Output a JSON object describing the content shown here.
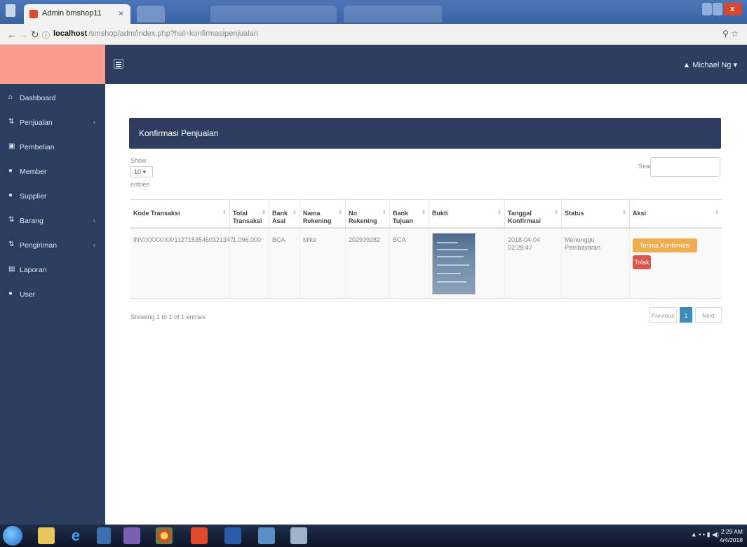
{
  "browser": {
    "tab_title": "Admin bmshop11",
    "tab_close": "×",
    "url_host": "localhost",
    "url_path": "/smshop/adm/index.php?hal=konfirmasipenjualan",
    "url_info_icon": "ⓘ"
  },
  "topbar": {
    "user_name": "Michael Ng ▾"
  },
  "sidebar": {
    "items": [
      {
        "label": "Dashboard",
        "icon": "home-icon",
        "glyph": "⌂",
        "has_chevron": false
      },
      {
        "label": "Penjualan",
        "icon": "transfer-icon",
        "glyph": "⇅",
        "has_chevron": true
      },
      {
        "label": "Pembelian",
        "icon": "money-icon",
        "glyph": "▣",
        "has_chevron": false
      },
      {
        "label": "Member",
        "icon": "users-icon",
        "glyph": "●",
        "has_chevron": false
      },
      {
        "label": "Supplier",
        "icon": "user-icon",
        "glyph": "●",
        "has_chevron": false
      },
      {
        "label": "Barang",
        "icon": "transfer-icon",
        "glyph": "⇅",
        "has_chevron": true
      },
      {
        "label": "Pengiriman",
        "icon": "transfer-icon",
        "glyph": "⇅",
        "has_chevron": true
      },
      {
        "label": "Laporan",
        "icon": "file-icon",
        "glyph": "▤",
        "has_chevron": false
      },
      {
        "label": "User",
        "icon": "user-icon",
        "glyph": "●",
        "has_chevron": false
      }
    ],
    "chevron": "‹"
  },
  "panel": {
    "title": "Konfirmasi Penjualan"
  },
  "controls": {
    "show_label": "Show",
    "show_value": "10 ▾",
    "entries_label": "entries",
    "search_label": "Search:"
  },
  "table": {
    "headers": [
      "Kode Transaksi",
      "Total\nTransaksi",
      "Bank\nAsal",
      "Nama\nRekening",
      "No\nRekening",
      "Bank\nTujuan",
      "Bukti",
      "Tanggal\nKonfirmasi",
      "Status",
      "Aksi"
    ],
    "rows": [
      {
        "kode": "INV/XXXX/XX/11271535460321347",
        "total": "1.096.000",
        "bank_asal": "BCA",
        "nama_rekening": "Mike",
        "no_rekening": "202939282",
        "bank_tujuan": "BCA",
        "tanggal": "2018-04-04\n02:28:47",
        "status": "Menunggu\nPembayaran",
        "btn_terima": "Terima Konfirmasi",
        "btn_tolak": "Tolak"
      }
    ]
  },
  "footer": {
    "info": "Showing 1 to 1 of 1 entries",
    "prev": "Previous",
    "page": "1",
    "next": "Next"
  },
  "taskbar": {
    "time": "2:29 AM",
    "date": "4/4/2018"
  }
}
